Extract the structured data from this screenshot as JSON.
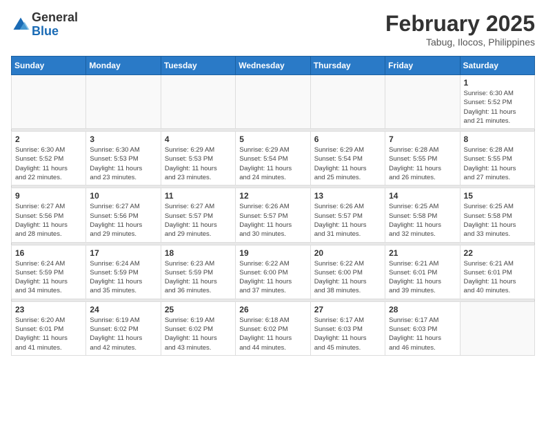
{
  "header": {
    "logo": {
      "general": "General",
      "blue": "Blue"
    },
    "title": "February 2025",
    "location": "Tabug, Ilocos, Philippines"
  },
  "calendar": {
    "days_of_week": [
      "Sunday",
      "Monday",
      "Tuesday",
      "Wednesday",
      "Thursday",
      "Friday",
      "Saturday"
    ],
    "weeks": [
      [
        {
          "day": "",
          "info": ""
        },
        {
          "day": "",
          "info": ""
        },
        {
          "day": "",
          "info": ""
        },
        {
          "day": "",
          "info": ""
        },
        {
          "day": "",
          "info": ""
        },
        {
          "day": "",
          "info": ""
        },
        {
          "day": "1",
          "info": "Sunrise: 6:30 AM\nSunset: 5:52 PM\nDaylight: 11 hours\nand 21 minutes."
        }
      ],
      [
        {
          "day": "2",
          "info": "Sunrise: 6:30 AM\nSunset: 5:52 PM\nDaylight: 11 hours\nand 22 minutes."
        },
        {
          "day": "3",
          "info": "Sunrise: 6:30 AM\nSunset: 5:53 PM\nDaylight: 11 hours\nand 23 minutes."
        },
        {
          "day": "4",
          "info": "Sunrise: 6:29 AM\nSunset: 5:53 PM\nDaylight: 11 hours\nand 23 minutes."
        },
        {
          "day": "5",
          "info": "Sunrise: 6:29 AM\nSunset: 5:54 PM\nDaylight: 11 hours\nand 24 minutes."
        },
        {
          "day": "6",
          "info": "Sunrise: 6:29 AM\nSunset: 5:54 PM\nDaylight: 11 hours\nand 25 minutes."
        },
        {
          "day": "7",
          "info": "Sunrise: 6:28 AM\nSunset: 5:55 PM\nDaylight: 11 hours\nand 26 minutes."
        },
        {
          "day": "8",
          "info": "Sunrise: 6:28 AM\nSunset: 5:55 PM\nDaylight: 11 hours\nand 27 minutes."
        }
      ],
      [
        {
          "day": "9",
          "info": "Sunrise: 6:27 AM\nSunset: 5:56 PM\nDaylight: 11 hours\nand 28 minutes."
        },
        {
          "day": "10",
          "info": "Sunrise: 6:27 AM\nSunset: 5:56 PM\nDaylight: 11 hours\nand 29 minutes."
        },
        {
          "day": "11",
          "info": "Sunrise: 6:27 AM\nSunset: 5:57 PM\nDaylight: 11 hours\nand 29 minutes."
        },
        {
          "day": "12",
          "info": "Sunrise: 6:26 AM\nSunset: 5:57 PM\nDaylight: 11 hours\nand 30 minutes."
        },
        {
          "day": "13",
          "info": "Sunrise: 6:26 AM\nSunset: 5:57 PM\nDaylight: 11 hours\nand 31 minutes."
        },
        {
          "day": "14",
          "info": "Sunrise: 6:25 AM\nSunset: 5:58 PM\nDaylight: 11 hours\nand 32 minutes."
        },
        {
          "day": "15",
          "info": "Sunrise: 6:25 AM\nSunset: 5:58 PM\nDaylight: 11 hours\nand 33 minutes."
        }
      ],
      [
        {
          "day": "16",
          "info": "Sunrise: 6:24 AM\nSunset: 5:59 PM\nDaylight: 11 hours\nand 34 minutes."
        },
        {
          "day": "17",
          "info": "Sunrise: 6:24 AM\nSunset: 5:59 PM\nDaylight: 11 hours\nand 35 minutes."
        },
        {
          "day": "18",
          "info": "Sunrise: 6:23 AM\nSunset: 5:59 PM\nDaylight: 11 hours\nand 36 minutes."
        },
        {
          "day": "19",
          "info": "Sunrise: 6:22 AM\nSunset: 6:00 PM\nDaylight: 11 hours\nand 37 minutes."
        },
        {
          "day": "20",
          "info": "Sunrise: 6:22 AM\nSunset: 6:00 PM\nDaylight: 11 hours\nand 38 minutes."
        },
        {
          "day": "21",
          "info": "Sunrise: 6:21 AM\nSunset: 6:01 PM\nDaylight: 11 hours\nand 39 minutes."
        },
        {
          "day": "22",
          "info": "Sunrise: 6:21 AM\nSunset: 6:01 PM\nDaylight: 11 hours\nand 40 minutes."
        }
      ],
      [
        {
          "day": "23",
          "info": "Sunrise: 6:20 AM\nSunset: 6:01 PM\nDaylight: 11 hours\nand 41 minutes."
        },
        {
          "day": "24",
          "info": "Sunrise: 6:19 AM\nSunset: 6:02 PM\nDaylight: 11 hours\nand 42 minutes."
        },
        {
          "day": "25",
          "info": "Sunrise: 6:19 AM\nSunset: 6:02 PM\nDaylight: 11 hours\nand 43 minutes."
        },
        {
          "day": "26",
          "info": "Sunrise: 6:18 AM\nSunset: 6:02 PM\nDaylight: 11 hours\nand 44 minutes."
        },
        {
          "day": "27",
          "info": "Sunrise: 6:17 AM\nSunset: 6:03 PM\nDaylight: 11 hours\nand 45 minutes."
        },
        {
          "day": "28",
          "info": "Sunrise: 6:17 AM\nSunset: 6:03 PM\nDaylight: 11 hours\nand 46 minutes."
        },
        {
          "day": "",
          "info": ""
        }
      ]
    ]
  }
}
